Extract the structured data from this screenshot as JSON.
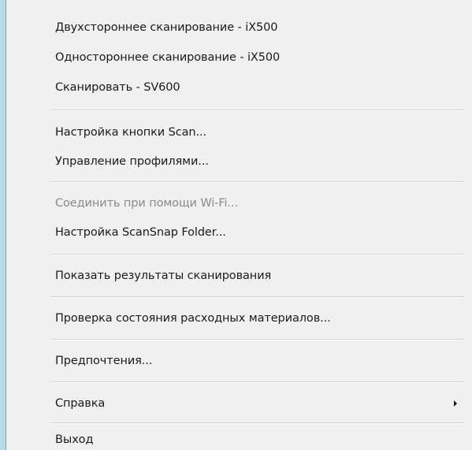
{
  "menu": {
    "items": [
      {
        "id": "duplex",
        "label": "Двухстороннее сканирование - iX500"
      },
      {
        "id": "simplex",
        "label": "Одностороннее сканирование - iX500"
      },
      {
        "id": "scan-sv600",
        "label": "Сканировать - SV600"
      },
      {
        "id": "scan-button-settings",
        "label": "Настройка кнопки Scan..."
      },
      {
        "id": "profile-management",
        "label": "Управление профилями..."
      },
      {
        "id": "wifi-connect",
        "label": "Соединить при помощи Wi-Fi..."
      },
      {
        "id": "scansnap-folder",
        "label": "Настройка ScanSnap Folder..."
      },
      {
        "id": "show-results",
        "label": "Показать результаты сканирования"
      },
      {
        "id": "consumables",
        "label": "Проверка состояния расходных материалов..."
      },
      {
        "id": "preferences",
        "label": "Предпочтения..."
      },
      {
        "id": "help",
        "label": "Справка"
      },
      {
        "id": "exit",
        "label": "Выход"
      }
    ]
  }
}
